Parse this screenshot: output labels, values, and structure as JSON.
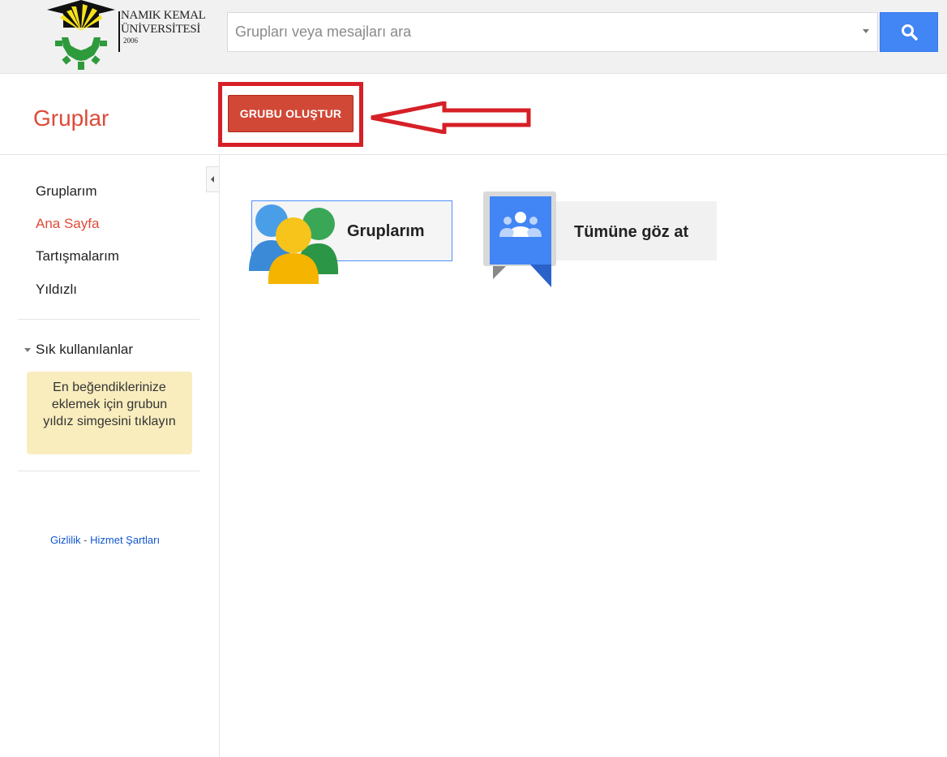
{
  "header": {
    "logo": {
      "line1": "NAMIK KEMAL",
      "line2": "ÜNİVERSİTESİ",
      "year": "2006"
    },
    "search": {
      "placeholder": "Grupları veya mesajları ara",
      "value": ""
    },
    "search_button_icon": "search-icon"
  },
  "toolbar": {
    "app_title": "Gruplar",
    "create_button": "GRUBU OLUŞTUR"
  },
  "sidebar": {
    "items": [
      {
        "label": "Gruplarım",
        "active": false
      },
      {
        "label": "Ana Sayfa",
        "active": true
      },
      {
        "label": "Tartışmalarım",
        "active": false
      },
      {
        "label": "Yıldızlı",
        "active": false
      }
    ],
    "favorites_header": "Sık kullanılanlar",
    "favorites_hint": [
      "En beğendiklerinize",
      "eklemek için grubun",
      "yıldız simgesini tıklayın"
    ],
    "footer": {
      "privacy": "Gizlilik",
      "separator": " - ",
      "terms": "Hizmet Şartları"
    }
  },
  "main": {
    "cards": [
      {
        "label": "Gruplarım",
        "icon": "people-icon"
      },
      {
        "label": "Tümüne göz at",
        "icon": "browse-groups-icon"
      }
    ]
  },
  "colors": {
    "accent_red": "#dd4b39",
    "button_red": "#d14836",
    "highlight_red": "#d62027",
    "search_blue": "#4285f4",
    "favorites_bg": "#f9edbe"
  }
}
